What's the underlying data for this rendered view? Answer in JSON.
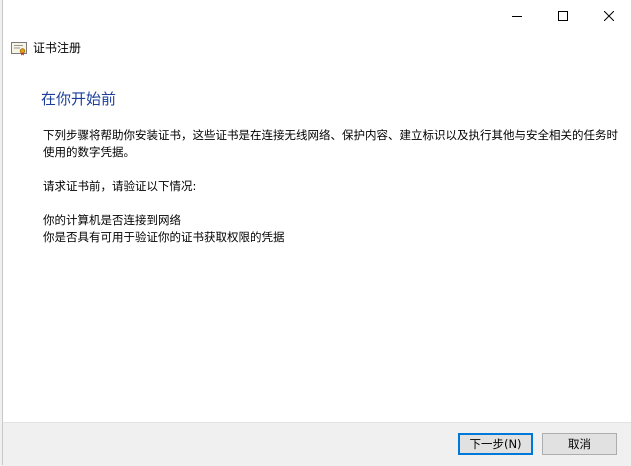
{
  "window": {
    "controls": {
      "minimize_icon": "minimize-icon",
      "maximize_icon": "maximize-icon",
      "close_icon": "close-icon"
    }
  },
  "header": {
    "title": "证书注册",
    "icon": "certificate-icon"
  },
  "main": {
    "heading": "在你开始前",
    "paragraph1": "下列步骤将帮助你安装证书，这些证书是在连接无线网络、保护内容、建立标识以及执行其他与安全相关的任务时使用的数字凭据。",
    "paragraph2": "请求证书前，请验证以下情况:",
    "requirements": [
      "你的计算机是否连接到网络",
      "你是否具有可用于验证你的证书获取权限的凭据"
    ]
  },
  "footer": {
    "next_label": "下一步(N)",
    "cancel_label": "取消"
  },
  "colors": {
    "heading": "#1b3f9b",
    "focus_border": "#0078d7"
  }
}
